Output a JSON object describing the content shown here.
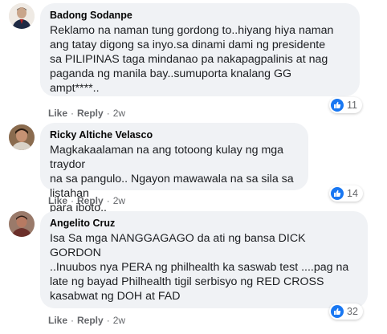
{
  "comments": [
    {
      "author": "Badong Sodanpe",
      "text": "Reklamo na naman tung gordong to..hiyang hiya naman\nang tatay digong sa inyo.sa dinami dami ng presidente\nsa PILIPINAS taga mindanao pa nakapagpalinis at nag\npaganda ng manila bay..sumuporta knalang GG\nampt****..",
      "like_label": "Like",
      "reply_label": "Reply",
      "time": "2w",
      "reactions": "11"
    },
    {
      "author": "Ricky Altiche Velasco",
      "text": "Magkakaalaman na ang totoong kulay ng mga traydor\nna sa pangulo.. Ngayon mawawala na sa sila sa listahan\npara iboto..",
      "like_label": "Like",
      "reply_label": "Reply",
      "time": "2w",
      "reactions": "14"
    },
    {
      "author": "Angelito Cruz",
      "text": "Isa Sa mga NANGGAGAGO da ati ng bansa DICK\nGORDON\n..Inuubos nya PERA ng philhealth ka saswab test ....pag na\nlate ng bayad Philhealth tigil serbisyo ng RED CROSS\nkasabwat ng DOH at FAD",
      "like_label": "Like",
      "reply_label": "Reply",
      "time": "2w",
      "reactions": "32"
    }
  ],
  "colors": {
    "bubble": "#f0f2f5",
    "like_blue": "#1877f2",
    "meta_gray": "#65676b"
  },
  "icons": [
    "avatar",
    "like-reaction-icon"
  ]
}
